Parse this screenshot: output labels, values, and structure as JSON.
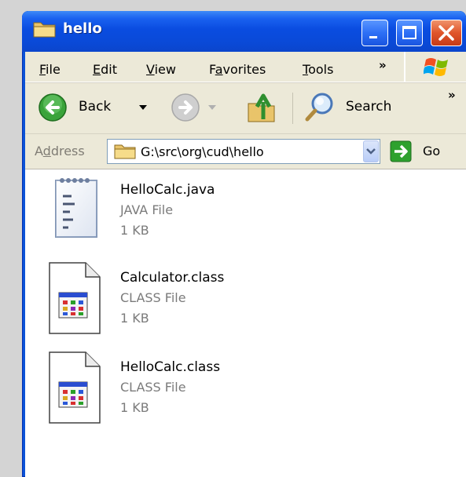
{
  "window": {
    "title": "hello",
    "colors": {
      "titlebar": "#0a4ce0",
      "close": "#e0552a",
      "bar_bg": "#ece9d8"
    }
  },
  "menu": {
    "items": [
      {
        "label": "File",
        "accel": "F",
        "rest": "ile"
      },
      {
        "label": "Edit",
        "accel": "E",
        "rest": "dit"
      },
      {
        "label": "View",
        "accel": "V",
        "rest": "iew"
      },
      {
        "label": "Favorites",
        "pre": "F",
        "accel": "a",
        "rest": "vorites"
      },
      {
        "label": "Tools",
        "accel": "T",
        "rest": "ools"
      }
    ],
    "overflow": "»"
  },
  "toolbar": {
    "back_label": "Back",
    "search_label": "Search",
    "overflow": "»"
  },
  "address": {
    "label_pre": "A",
    "label_accel": "d",
    "label_rest": "dress",
    "value": "G:\\src\\org\\cud\\hello",
    "go_label": "Go"
  },
  "files": [
    {
      "name": "HelloCalc.java",
      "type": "JAVA File",
      "size": "1 KB",
      "icon": "text-file-icon"
    },
    {
      "name": "Calculator.class",
      "type": "CLASS File",
      "size": "1 KB",
      "icon": "class-file-icon"
    },
    {
      "name": "HelloCalc.class",
      "type": "CLASS File",
      "size": "1 KB",
      "icon": "class-file-icon"
    }
  ]
}
